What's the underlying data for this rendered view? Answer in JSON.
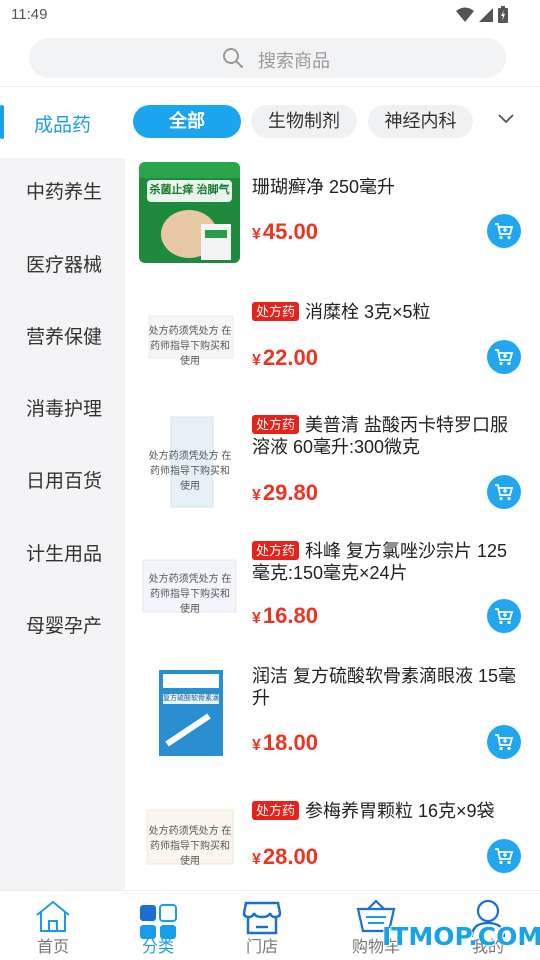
{
  "status_bar": {
    "time": "11:49"
  },
  "search": {
    "placeholder": "搜索商品"
  },
  "categories": {
    "active": "成品药",
    "items": [
      "中药养生",
      "医疗器械",
      "营养保健",
      "消毒护理",
      "日用百货",
      "计生用品",
      "母婴孕产"
    ]
  },
  "tabs": [
    {
      "label": "全部",
      "active": true
    },
    {
      "label": "生物制剂",
      "active": false
    },
    {
      "label": "神经内科",
      "active": false
    }
  ],
  "products": [
    {
      "name": "珊瑚癣净 250毫升",
      "rx": "",
      "price": "45.00",
      "image_text": "杀菌止痒 治脚气"
    },
    {
      "name": "消糜栓 3克×5粒",
      "rx": "处方药",
      "price": "22.00",
      "image_text": "处方药须凭处方 在药师指导下购买和使用"
    },
    {
      "name": "美普清 盐酸丙卡特罗口服溶液 60毫升:300微克",
      "rx": "处方药",
      "price": "29.80",
      "image_text": "处方药须凭处方 在药师指导下购买和使用"
    },
    {
      "name": "科峰 复方氯唑沙宗片 125毫克:150毫克×24片",
      "rx": "处方药",
      "price": "16.80",
      "image_text": "处方药须凭处方 在药师指导下购买和使用"
    },
    {
      "name": "润洁 复方硫酸软骨素滴眼液 15毫升",
      "rx": "",
      "price": "18.00",
      "image_text": "复方硫酸软骨素滴眼液"
    },
    {
      "name": "参梅养胃颗粒 16克×9袋",
      "rx": "处方药",
      "price": "28.00",
      "image_text": "处方药须凭处方 在药师指导下购买和使用"
    }
  ],
  "currency": "¥",
  "bottom_nav": [
    {
      "label": "首页",
      "icon": "home-icon"
    },
    {
      "label": "分类",
      "icon": "category-icon",
      "active": true
    },
    {
      "label": "门店",
      "icon": "store-icon"
    },
    {
      "label": "购物车",
      "icon": "cart-icon"
    },
    {
      "label": "我的",
      "icon": "user-icon"
    }
  ],
  "watermark": "ITMOP.COM",
  "colors": {
    "accent": "#1aa5ee",
    "price": "#ee3322",
    "rx_badge": "#e5231b"
  }
}
